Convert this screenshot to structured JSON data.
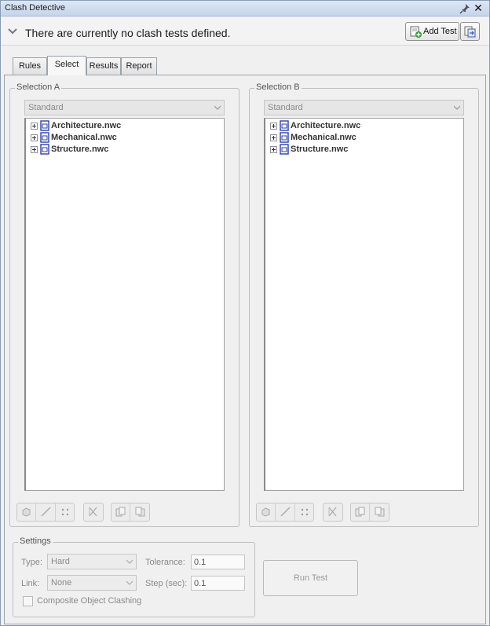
{
  "window": {
    "title": "Clash Detective"
  },
  "header": {
    "message": "There are currently no clash tests defined.",
    "add_test_label": "Add Test"
  },
  "tabs": [
    {
      "label": "Rules"
    },
    {
      "label": "Select"
    },
    {
      "label": "Results"
    },
    {
      "label": "Report"
    }
  ],
  "selection_a": {
    "legend": "Selection A",
    "mode": "Standard",
    "files": [
      "Architecture.nwc",
      "Mechanical.nwc",
      "Structure.nwc"
    ]
  },
  "selection_b": {
    "legend": "Selection B",
    "mode": "Standard",
    "files": [
      "Architecture.nwc",
      "Mechanical.nwc",
      "Structure.nwc"
    ]
  },
  "settings": {
    "legend": "Settings",
    "type_label": "Type:",
    "type_value": "Hard",
    "link_label": "Link:",
    "link_value": "None",
    "tolerance_label": "Tolerance:",
    "tolerance_value": "0.1",
    "step_label": "Step (sec):",
    "step_value": "0.1",
    "composite_label": "Composite Object Clashing",
    "composite_checked": false
  },
  "run_test_label": "Run Test",
  "colors": {
    "titlebar": "#c6d5ea",
    "file_icon": "#2b3fb0",
    "add_icon": "#2f9a2f"
  }
}
